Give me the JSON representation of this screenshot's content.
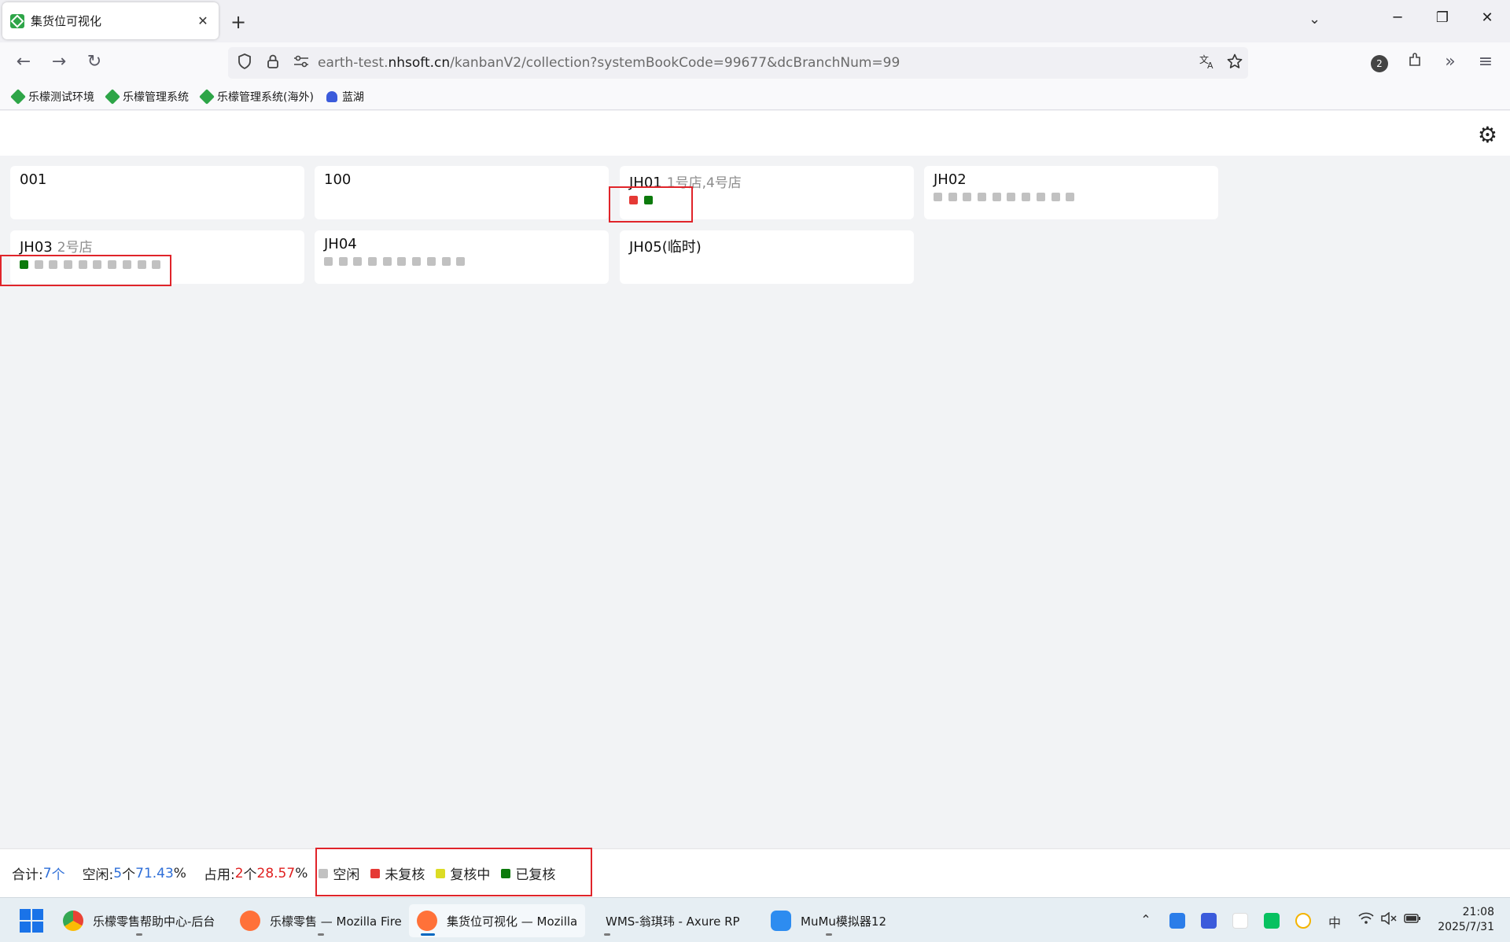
{
  "browser": {
    "tab_title": "集货位可视化",
    "tab_close": "✕",
    "new_tab": "+",
    "tabs_dropdown": "⌄",
    "url_prefix": "earth-test.",
    "url_domain": "nhsoft.cn",
    "url_path": "/kanbanV2/collection?systemBookCode=99677&dcBranchNum=99",
    "extensions_badge": "2",
    "window_minimize": "─",
    "window_restore": "❐",
    "window_close": "✕",
    "nav_back": "←",
    "nav_forward": "→",
    "nav_reload": "↻",
    "more_tools": "»",
    "app_menu": "≡"
  },
  "bookmarks": [
    {
      "label": "乐檬测试环境"
    },
    {
      "label": "乐檬管理系统"
    },
    {
      "label": "乐檬管理系统(海外)"
    },
    {
      "label": "蓝湖"
    }
  ],
  "settings_icon": "⚙",
  "cards": [
    {
      "name": "001",
      "sub": "",
      "slots": []
    },
    {
      "name": "100",
      "sub": "",
      "slots": []
    },
    {
      "name": "JH01",
      "sub": "1号店,4号店",
      "slots": [
        "red",
        "green"
      ]
    },
    {
      "name": "JH02",
      "sub": "",
      "slots": [
        "gray",
        "gray",
        "gray",
        "gray",
        "gray",
        "gray",
        "gray",
        "gray",
        "gray",
        "gray"
      ]
    },
    {
      "name": "JH03",
      "sub": "2号店",
      "slots": [
        "green",
        "gray",
        "gray",
        "gray",
        "gray",
        "gray",
        "gray",
        "gray",
        "gray",
        "gray"
      ]
    },
    {
      "name": "JH04",
      "sub": "",
      "slots": [
        "gray",
        "gray",
        "gray",
        "gray",
        "gray",
        "gray",
        "gray",
        "gray",
        "gray",
        "gray"
      ]
    },
    {
      "name": "JH05(临时)",
      "sub": "",
      "slots": []
    }
  ],
  "footer": {
    "total_label": "合计:",
    "total_count": "7",
    "unit": "个",
    "idle_label": "空闲:",
    "idle_count": "5",
    "idle_pct": "71.43",
    "occupied_label": "占用:",
    "occupied_count": "2",
    "occupied_pct": "28.57",
    "pct_sign": "%"
  },
  "legend": [
    {
      "label": "空闲",
      "color": "#c1c1c1"
    },
    {
      "label": "未复核",
      "color": "#e53935"
    },
    {
      "label": "复核中",
      "color": "#dcdc24"
    },
    {
      "label": "已复核",
      "color": "#0c7a0c"
    }
  ],
  "taskbar": {
    "apps": [
      {
        "label": "乐檬零售帮助中心-后台",
        "color": "#e0442f"
      },
      {
        "label": "乐檬零售 — Mozilla Fire",
        "color": "#ff7139"
      },
      {
        "label": "集货位可视化 — Mozilla",
        "color": "#ff7139"
      },
      {
        "label": "WMS-翁琪玮 - Axure RP",
        "color": ""
      },
      {
        "label": "MuMu模拟器12",
        "color": "#2d8cf0"
      }
    ],
    "clock_time": "21:08",
    "clock_date": "2025/7/31"
  }
}
